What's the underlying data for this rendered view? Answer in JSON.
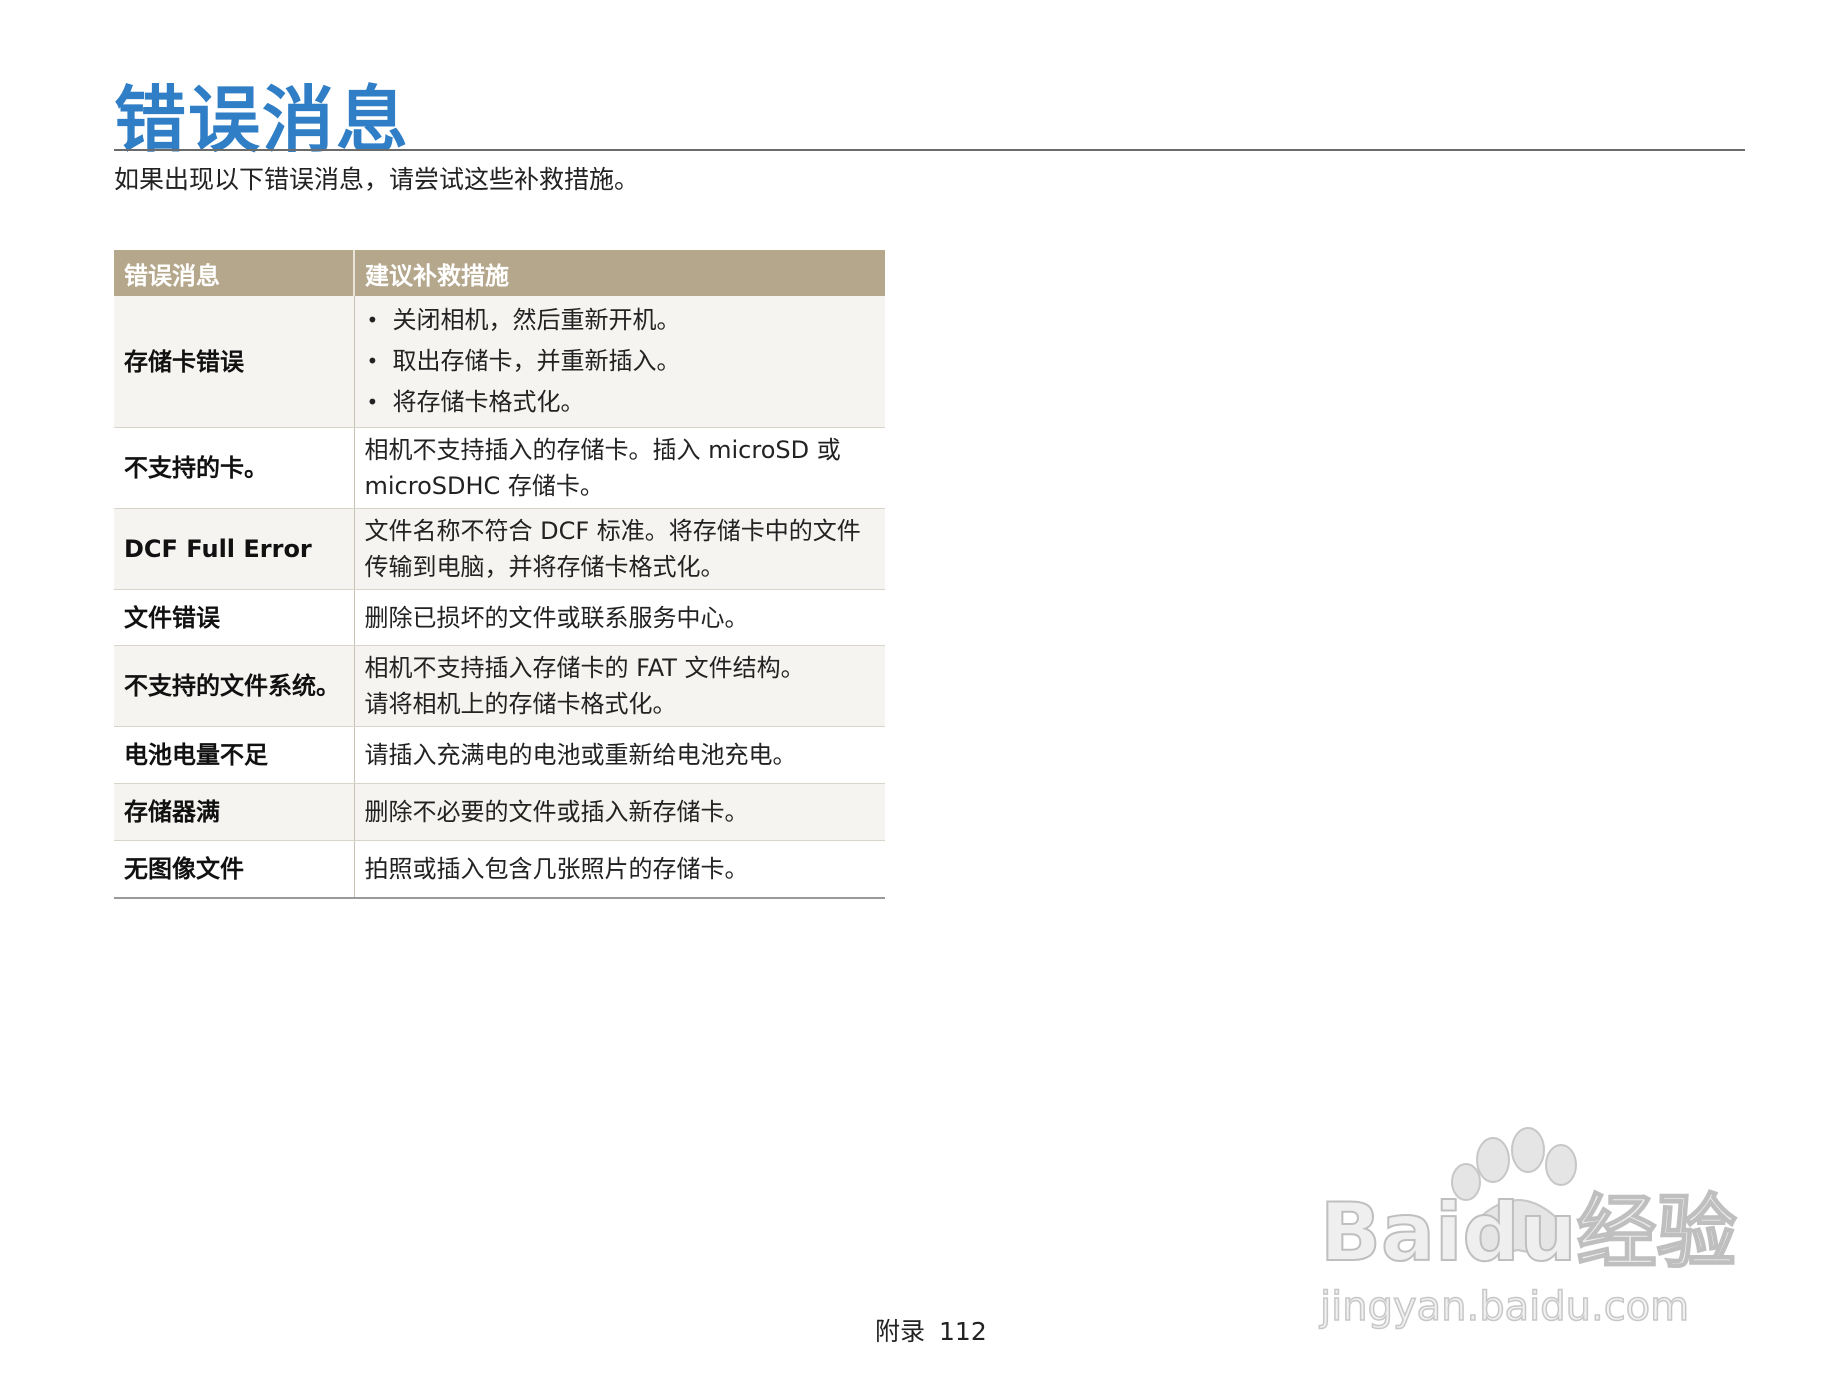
{
  "page": {
    "title": "错误消息",
    "intro": "如果出现以下错误消息，请尝试这些补救措施。"
  },
  "table": {
    "headers": [
      "错误消息",
      "建议补救措施"
    ],
    "rows": [
      {
        "message": "存储卡错误",
        "remedies": [
          "关闭相机，然后重新开机。",
          "取出存储卡，并重新插入。",
          "将存储卡格式化。"
        ]
      },
      {
        "message": "不支持的卡。",
        "remedy": "相机不支持插入的存储卡。插入 microSD 或 microSDHC 存储卡。"
      },
      {
        "message": "DCF Full Error",
        "remedy": "文件名称不符合 DCF 标准。将存储卡中的文件传输到电脑，并将存储卡格式化。"
      },
      {
        "message": "文件错误",
        "remedy": "删除已损坏的文件或联系服务中心。"
      },
      {
        "message": "不支持的文件系统。",
        "remedy_lines": [
          "相机不支持插入存储卡的 FAT 文件结构。",
          "请将相机上的存储卡格式化。"
        ]
      },
      {
        "message": "电池电量不足",
        "remedy": "请插入充满电的电池或重新给电池充电。"
      },
      {
        "message": "存储器满",
        "remedy": "删除不必要的文件或插入新存储卡。"
      },
      {
        "message": "无图像文件",
        "remedy": "拍照或插入包含几张照片的存储卡。"
      }
    ]
  },
  "footer": {
    "section": "附录",
    "page_number": "112"
  },
  "watermark": {
    "brand": "Baidu经验",
    "url": "jingyan.baidu.com",
    "icon": "paw-icon"
  },
  "colors": {
    "title": "#2f7ec6",
    "header_bg": "#b5a78c",
    "row_alt_bg": "#f5f4f1"
  }
}
